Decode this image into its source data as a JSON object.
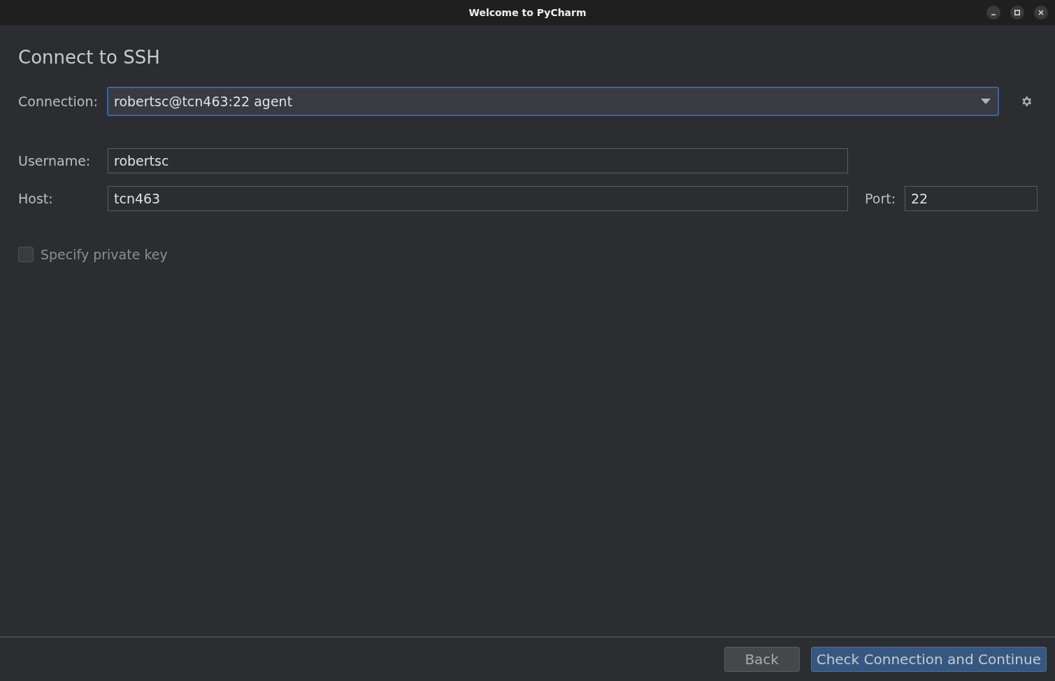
{
  "window": {
    "title": "Welcome to PyCharm"
  },
  "heading": "Connect to SSH",
  "connection": {
    "label": "Connection:",
    "value": "robertsc@tcn463:22 agent",
    "focused": true
  },
  "username": {
    "label": "Username:",
    "value": "robertsc"
  },
  "host": {
    "label": "Host:",
    "value": "tcn463"
  },
  "port": {
    "label": "Port:",
    "value": "22"
  },
  "private_key": {
    "label": "Specify private key",
    "checked": false
  },
  "buttons": [
    {
      "label": "Back",
      "kind": "secondary"
    },
    {
      "label": "Check Connection and Continue",
      "kind": "primary"
    }
  ]
}
